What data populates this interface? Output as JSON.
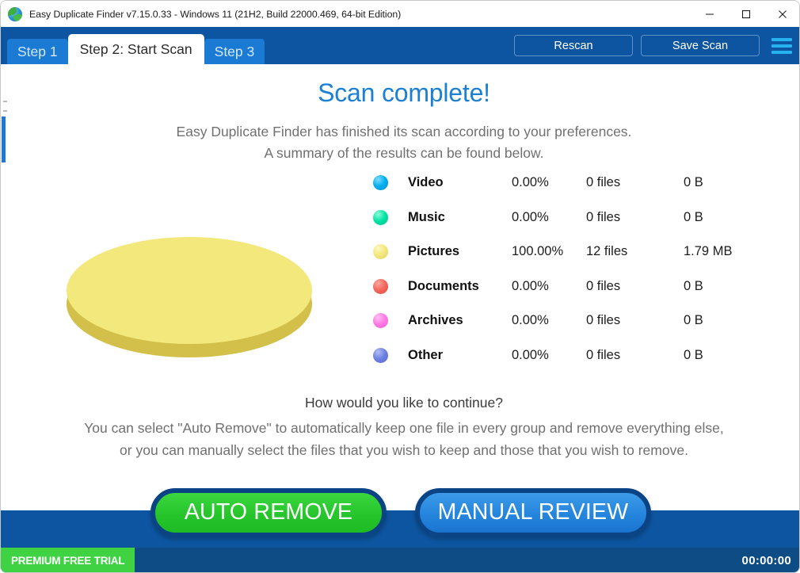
{
  "window": {
    "title": "Easy Duplicate Finder v7.15.0.33 - Windows 11 (21H2, Build 22000.469, 64-bit Edition)",
    "app_icon": "recycle-globe-icon",
    "minimize_label": "–",
    "maximize_label": "□",
    "close_label": "✕"
  },
  "header": {
    "tabs": [
      {
        "label": "Step 1",
        "active": false
      },
      {
        "label": "Step 2: Start Scan",
        "active": true
      },
      {
        "label": "Step 3",
        "active": false
      }
    ],
    "rescan_label": "Rescan",
    "save_scan_label": "Save Scan",
    "menu_icon": "hamburger-menu-icon",
    "bar_color": "#0d55a0",
    "tab_inactive_color": "#1a7ad4",
    "menu_icon_color": "#27b3f2"
  },
  "main": {
    "headline": "Scan complete!",
    "headline_color": "#1b7fd4",
    "subtext_line1": "Easy Duplicate Finder has finished its scan according to your preferences.",
    "subtext_line2": "A summary of the results can be found below.",
    "continue_question": "How would you like to continue?",
    "continue_line1": "You can select \"Auto Remove\" to automatically keep one file in every group and remove everything else,",
    "continue_line2": "or you can manually select the files that you wish to keep and those that you wish to remove."
  },
  "chart_data": {
    "type": "pie",
    "title": "Scan results by file category",
    "style": "3d-pie",
    "categories": [
      "Video",
      "Music",
      "Pictures",
      "Documents",
      "Archives",
      "Other"
    ],
    "values": [
      0.0,
      0.0,
      100.0,
      0.0,
      0.0,
      0.0
    ],
    "value_unit": "percent",
    "colors": [
      "#00aef0",
      "#00e3a4",
      "#f3e87c",
      "#f4675d",
      "#ff7ae4",
      "#6d80df"
    ],
    "side_color": "#d2c04a",
    "legend_position": "right",
    "legend_columns": [
      "category",
      "percent",
      "files",
      "size"
    ],
    "rows": [
      {
        "name": "Video",
        "color": "#00aef0",
        "percent": "0.00%",
        "files": "0 files",
        "size": "0 B"
      },
      {
        "name": "Music",
        "color": "#00e3a4",
        "percent": "0.00%",
        "files": "0 files",
        "size": "0 B"
      },
      {
        "name": "Pictures",
        "color": "#f3e87c",
        "percent": "100.00%",
        "files": "12 files",
        "size": "1.79 MB"
      },
      {
        "name": "Documents",
        "color": "#f4675d",
        "percent": "0.00%",
        "files": "0 files",
        "size": "0 B"
      },
      {
        "name": "Archives",
        "color": "#ff7ae4",
        "percent": "0.00%",
        "files": "0 files",
        "size": "0 B"
      },
      {
        "name": "Other",
        "color": "#6d80df",
        "percent": "0.00%",
        "files": "0 files",
        "size": "0 B"
      }
    ]
  },
  "actions": {
    "auto_remove_label": "AUTO REMOVE",
    "manual_review_label": "MANUAL REVIEW",
    "auto_remove_color": "#27c52c",
    "manual_review_color": "#2585dd"
  },
  "statusbar": {
    "trial_label": "PREMIUM FREE TRIAL",
    "trial_color": "#3fd343",
    "timer": "00:00:00",
    "bar_color": "#0d4c84"
  }
}
